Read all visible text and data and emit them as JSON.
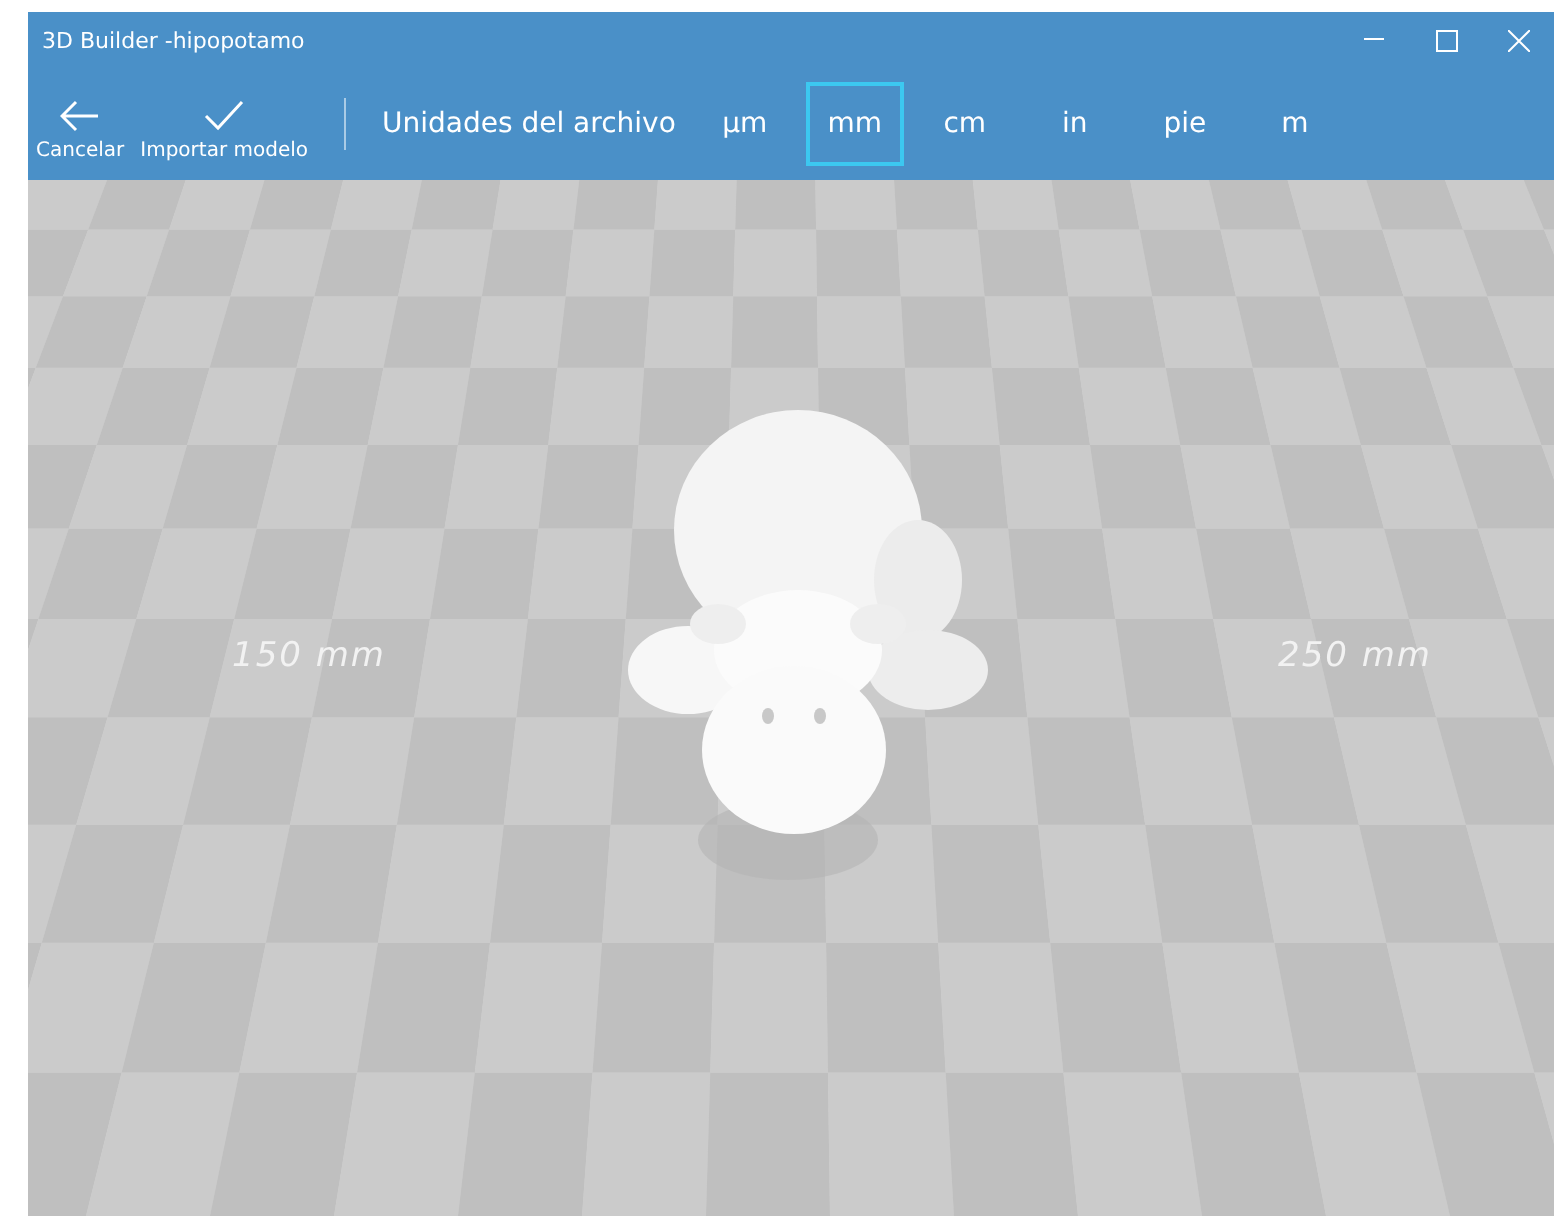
{
  "window": {
    "title": "3D Builder -hipopotamo"
  },
  "toolbar": {
    "actions": [
      {
        "label": "Cancelar",
        "kind": "back"
      },
      {
        "label": "Importar modelo",
        "kind": "check"
      }
    ],
    "units_label": "Unidades del archivo",
    "units": [
      {
        "label": "µm",
        "selected": false
      },
      {
        "label": "mm",
        "selected": true
      },
      {
        "label": "cm",
        "selected": false
      },
      {
        "label": "in",
        "selected": false
      },
      {
        "label": "pie",
        "selected": false
      },
      {
        "label": "m",
        "selected": false
      }
    ]
  },
  "viewport": {
    "scale_labels": [
      "150 mm",
      "250 mm"
    ]
  }
}
